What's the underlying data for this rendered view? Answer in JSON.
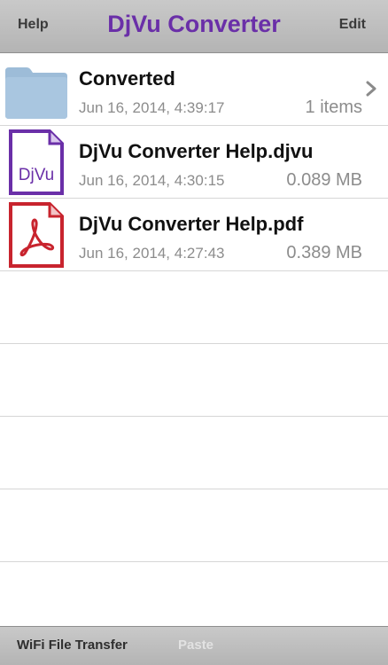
{
  "navbar": {
    "left_label": "Help",
    "title": "DjVu Converter",
    "right_label": "Edit",
    "title_color": "#6a2fa8"
  },
  "files": [
    {
      "name": "Converted",
      "date": "Jun 16, 2014, 4:39:17",
      "size": "1 items",
      "icon": "folder-icon",
      "has_chevron": true
    },
    {
      "name": "DjVu Converter Help.djvu",
      "date": "Jun 16, 2014, 4:30:15",
      "size": "0.089 MB",
      "icon": "djvu-file-icon",
      "icon_text": "DjVu",
      "has_chevron": false
    },
    {
      "name": "DjVu Converter Help.pdf",
      "date": "Jun 16, 2014, 4:27:43",
      "size": "0.389 MB",
      "icon": "pdf-file-icon",
      "has_chevron": false
    }
  ],
  "toolbar": {
    "wifi_label": "WiFi File Transfer",
    "paste_label": "Paste"
  },
  "colors": {
    "folder": "#a9c6e0",
    "djvu_accent": "#6a2fa8",
    "pdf_accent": "#c8242e"
  }
}
